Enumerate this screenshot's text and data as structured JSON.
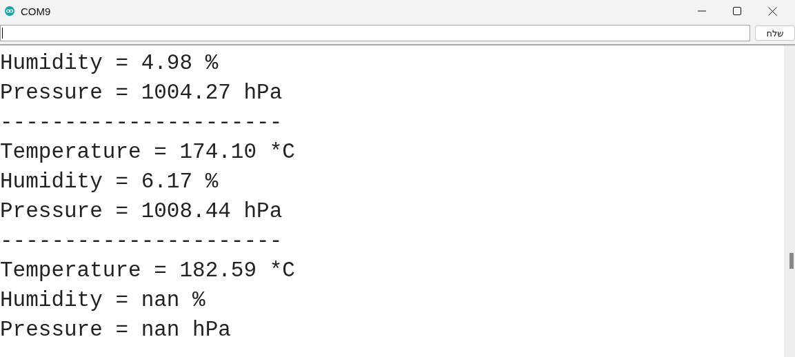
{
  "window": {
    "title": "COM9"
  },
  "send_bar": {
    "button": "שלח"
  },
  "output": {
    "lines": [
      "Humidity = 4.98 %",
      "Pressure = 1004.27 hPa",
      "----------------------",
      "Temperature = 174.10 *C",
      "Humidity = 6.17 %",
      "Pressure = 1008.44 hPa",
      "----------------------",
      "Temperature = 182.59 *C",
      "Humidity = nan %",
      "Pressure = nan hPa"
    ]
  }
}
